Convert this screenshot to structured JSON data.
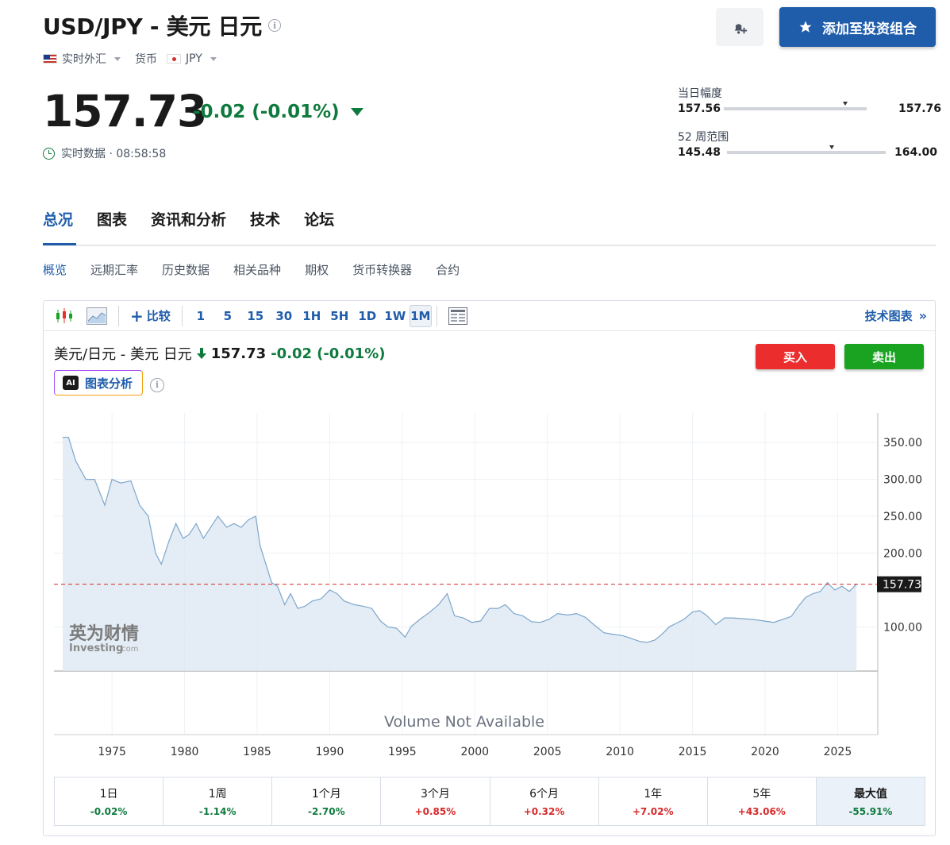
{
  "header": {
    "title": "USD/JPY - 美元 日元",
    "market_label": "实时外汇",
    "type_label": "货币",
    "currency": "JPY",
    "alert_button": "bell-plus-icon",
    "add_portfolio_label": "添加至投资组合"
  },
  "quote": {
    "price": "157.73",
    "change": "-0.02",
    "change_pct": "(-0.01%)",
    "realtime_text": "实时数据 · 08:58:58"
  },
  "day_range": {
    "label": "当日幅度",
    "low": "157.56",
    "high": "157.76",
    "current_fraction": 0.85
  },
  "week52_range": {
    "label": "52 周范围",
    "low": "145.48",
    "high": "164.00",
    "current_fraction": 0.66
  },
  "tabs": [
    "总况",
    "图表",
    "资讯和分析",
    "技术",
    "论坛"
  ],
  "subtabs": [
    "概览",
    "远期汇率",
    "历史数据",
    "相关品种",
    "期权",
    "货币转换器",
    "合约"
  ],
  "toolbar": {
    "compare": "比较",
    "intervals": [
      "1",
      "5",
      "15",
      "30",
      "1H",
      "5H",
      "1D",
      "1W",
      "1M"
    ],
    "selected_interval": "1M",
    "tech_chart": "技术图表"
  },
  "chart_header": {
    "name": "美元/日元 - 美元 日元",
    "price": "157.73",
    "change": "-0.02",
    "change_pct": "(-0.01%)",
    "ai_label": "图表分析",
    "buy": "买入",
    "sell": "卖出"
  },
  "watermark": {
    "cn": "英为财情",
    "en": "Investing",
    "suffix": ".com"
  },
  "volume_text": "Volume Not Available",
  "chart_data": {
    "type": "area",
    "y_ticks": [
      "350.00",
      "300.00",
      "250.00",
      "200.00",
      "100.00"
    ],
    "x_ticks": [
      "1975",
      "1980",
      "1985",
      "1990",
      "1995",
      "2000",
      "2005",
      "2010",
      "2015",
      "2020",
      "2025"
    ],
    "last_label": "157.73",
    "ylim": [
      40,
      390
    ],
    "xlim": [
      1971.0,
      2027.0
    ],
    "ref_line": 157.73,
    "x": [
      1971.6,
      1972.0,
      1972.5,
      1973.2,
      1973.8,
      1974.5,
      1975.0,
      1975.6,
      1976.3,
      1976.9,
      1977.5,
      1978.0,
      1978.4,
      1978.9,
      1979.4,
      1979.9,
      1980.3,
      1980.8,
      1981.3,
      1981.8,
      1982.3,
      1982.9,
      1983.4,
      1983.9,
      1984.4,
      1984.9,
      1985.2,
      1985.6,
      1986.0,
      1986.4,
      1986.9,
      1987.3,
      1987.8,
      1988.3,
      1988.8,
      1989.4,
      1990.0,
      1990.5,
      1991.0,
      1991.7,
      1992.3,
      1992.9,
      1993.5,
      1994.0,
      1994.6,
      1995.2,
      1995.6,
      1996.2,
      1996.9,
      1997.5,
      1998.1,
      1998.6,
      1999.2,
      1999.8,
      2000.4,
      2001.0,
      2001.6,
      2002.1,
      2002.7,
      2003.3,
      2003.9,
      2004.5,
      2005.1,
      2005.7,
      2006.4,
      2007.0,
      2007.6,
      2008.2,
      2008.9,
      2009.5,
      2010.2,
      2010.8,
      2011.4,
      2011.9,
      2012.4,
      2012.9,
      2013.4,
      2013.9,
      2014.4,
      2015.0,
      2015.5,
      2016.0,
      2016.6,
      2017.2,
      2017.8,
      2018.5,
      2019.2,
      2019.9,
      2020.6,
      2021.2,
      2021.8,
      2022.3,
      2022.8,
      2023.3,
      2023.8,
      2024.3,
      2024.8,
      2025.3,
      2025.8,
      2026.3
    ],
    "y": [
      357,
      357,
      325,
      300,
      300,
      265,
      300,
      295,
      298,
      265,
      250,
      200,
      185,
      215,
      240,
      220,
      225,
      240,
      220,
      235,
      250,
      235,
      240,
      235,
      245,
      250,
      210,
      185,
      160,
      155,
      130,
      145,
      125,
      128,
      135,
      138,
      150,
      145,
      135,
      130,
      128,
      125,
      108,
      100,
      98,
      86,
      100,
      110,
      120,
      130,
      145,
      115,
      112,
      106,
      108,
      125,
      125,
      130,
      118,
      115,
      107,
      106,
      110,
      118,
      116,
      118,
      113,
      103,
      92,
      90,
      88,
      84,
      80,
      79,
      82,
      90,
      100,
      105,
      110,
      120,
      122,
      115,
      103,
      112,
      112,
      111,
      110,
      108,
      106,
      110,
      114,
      128,
      140,
      145,
      148,
      160,
      150,
      155,
      148,
      158
    ]
  },
  "performance": [
    {
      "label": "1日",
      "value": "-0.02%",
      "dir": "neg"
    },
    {
      "label": "1周",
      "value": "-1.14%",
      "dir": "neg"
    },
    {
      "label": "1个月",
      "value": "-2.70%",
      "dir": "neg"
    },
    {
      "label": "3个月",
      "value": "+0.85%",
      "dir": "pos"
    },
    {
      "label": "6个月",
      "value": "+0.32%",
      "dir": "pos"
    },
    {
      "label": "1年",
      "value": "+7.02%",
      "dir": "pos"
    },
    {
      "label": "5年",
      "value": "+43.06%",
      "dir": "pos"
    },
    {
      "label": "最大值",
      "value": "-55.91%",
      "dir": "neg"
    }
  ]
}
